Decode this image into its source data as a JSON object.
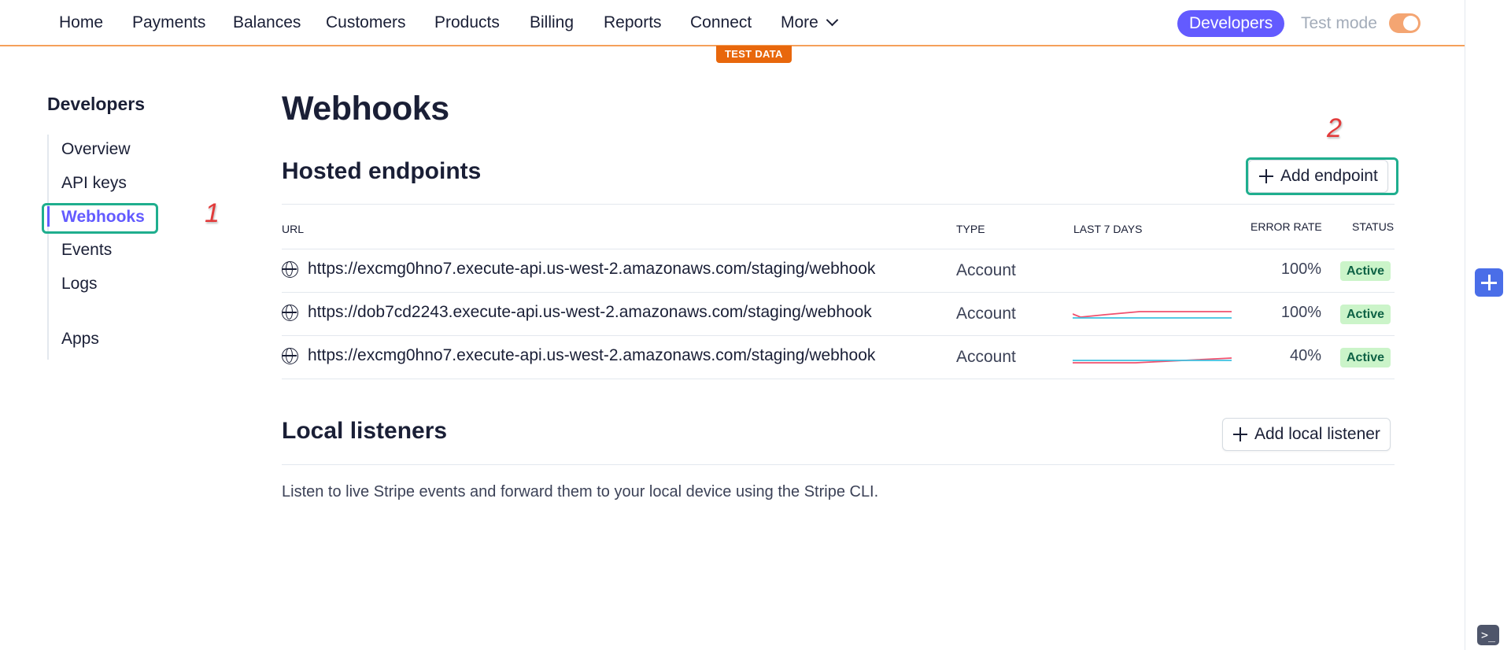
{
  "nav": {
    "items": [
      "Home",
      "Payments",
      "Balances",
      "Customers",
      "Products",
      "Billing",
      "Reports",
      "Connect"
    ],
    "more_label": "More",
    "developers_label": "Developers",
    "test_mode_label": "Test mode",
    "test_mode_on": true,
    "test_data_badge": "TEST DATA"
  },
  "sidebar": {
    "title": "Developers",
    "items": [
      {
        "label": "Overview"
      },
      {
        "label": "API keys"
      },
      {
        "label": "Webhooks",
        "active": true
      },
      {
        "label": "Events"
      },
      {
        "label": "Logs"
      },
      {
        "label": "Apps"
      }
    ]
  },
  "annotations": {
    "step1": "1",
    "step2": "2"
  },
  "page": {
    "title": "Webhooks"
  },
  "hosted": {
    "title": "Hosted endpoints",
    "add_button": "Add endpoint",
    "columns": {
      "url": "URL",
      "type": "TYPE",
      "last7": "LAST 7 DAYS",
      "error_rate": "ERROR RATE",
      "status": "STATUS"
    },
    "rows": [
      {
        "url": "https://excmg0hno7.execute-api.us-west-2.amazonaws.com/staging/webhook",
        "type": "Account",
        "error_rate": "100%",
        "status": "Active"
      },
      {
        "url": "https://dob7cd2243.execute-api.us-west-2.amazonaws.com/staging/webhook",
        "type": "Account",
        "error_rate": "100%",
        "status": "Active"
      },
      {
        "url": "https://excmg0hno7.execute-api.us-west-2.amazonaws.com/staging/webhook",
        "type": "Account",
        "error_rate": "40%",
        "status": "Active"
      }
    ]
  },
  "local": {
    "title": "Local listeners",
    "add_button": "Add local listener",
    "description": "Listen to live Stripe events and forward them to your local device using the Stripe CLI."
  },
  "colors": {
    "accent": "#635bff",
    "test_orange": "#e8670c",
    "highlight": "#1fae8e",
    "active_badge_bg": "#cbf4c9",
    "spark_red": "#f0506e",
    "spark_blue": "#3ec1e0"
  }
}
